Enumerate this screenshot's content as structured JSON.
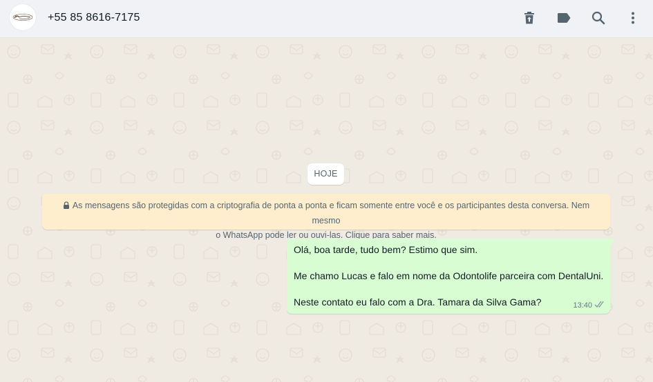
{
  "header": {
    "contact_name": "+55 85 8616-7175",
    "avatar_logo_text": "Dental Image",
    "icons": [
      "delete-icon",
      "label-icon",
      "search-icon",
      "menu-icon"
    ]
  },
  "chat": {
    "day_chip": "HOJE",
    "encryption_notice": {
      "line1": "As mensagens são protegidas com a criptografia de ponta a ponta e ficam somente entre você e os participantes desta conversa. Nem mesmo",
      "line2": "o WhatsApp pode ler ou ouvi-las. Clique para saber mais."
    },
    "messages": [
      {
        "direction": "outgoing",
        "lines": [
          "Olá, boa tarde, tudo bem? Estimo que sim.",
          "Me chamo Lucas e falo em nome da Odontolife parceira com DentalUni.",
          "Neste contato eu falo com a Dra. Tamara da Silva Gama?"
        ],
        "time": "13:40",
        "status": "delivered"
      }
    ]
  },
  "colors": {
    "header_bg": "#f0f2f5",
    "chat_bg": "#efeae2",
    "outgoing_bubble": "#d9fdd3",
    "notice_bg": "#ffeecd",
    "icon": "#54656f"
  }
}
